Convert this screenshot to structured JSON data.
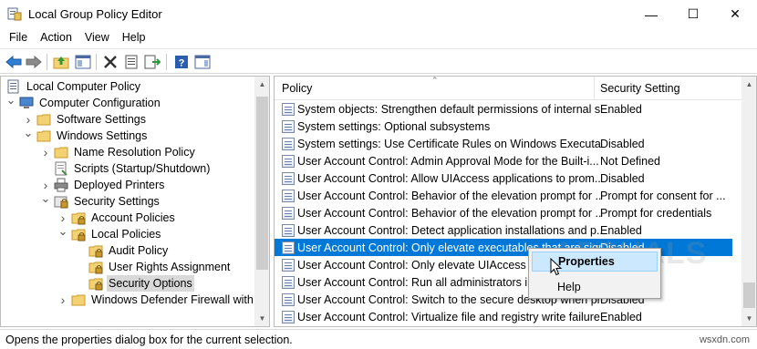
{
  "window": {
    "title": "Local Group Policy Editor",
    "minimize_glyph": "—",
    "maximize_glyph": "☐",
    "close_glyph": "✕"
  },
  "menu": [
    "File",
    "Action",
    "View",
    "Help"
  ],
  "toolbar": {
    "icons": [
      "back-icon",
      "forward-icon",
      "up-folder-icon",
      "show-hide-tree-icon",
      "delete-icon",
      "properties-icon",
      "export-list-icon",
      "help-icon",
      "show-pane-icon"
    ]
  },
  "tree": {
    "items": [
      {
        "label": "Local Computer Policy",
        "level": 0,
        "toggle": "",
        "icon": "computer-policy-icon"
      },
      {
        "label": "Computer Configuration",
        "level": 0,
        "toggle": "expanded",
        "icon": "computer-icon"
      },
      {
        "label": "Software Settings",
        "level": 1,
        "toggle": "collapsed",
        "icon": "folder-icon"
      },
      {
        "label": "Windows Settings",
        "level": 1,
        "toggle": "expanded",
        "icon": "folder-icon"
      },
      {
        "label": "Name Resolution Policy",
        "level": 2,
        "toggle": "collapsed",
        "icon": "folder-icon"
      },
      {
        "label": "Scripts (Startup/Shutdown)",
        "level": 2,
        "toggle": "",
        "icon": "script-icon"
      },
      {
        "label": "Deployed Printers",
        "level": 2,
        "toggle": "collapsed",
        "icon": "printer-icon"
      },
      {
        "label": "Security Settings",
        "level": 2,
        "toggle": "expanded",
        "icon": "security-icon"
      },
      {
        "label": "Account Policies",
        "level": 3,
        "toggle": "collapsed",
        "icon": "locked-folder-icon"
      },
      {
        "label": "Local Policies",
        "level": 3,
        "toggle": "expanded",
        "icon": "locked-folder-icon"
      },
      {
        "label": "Audit Policy",
        "level": 4,
        "toggle": "",
        "icon": "locked-folder-icon"
      },
      {
        "label": "User Rights Assignment",
        "level": 4,
        "toggle": "",
        "icon": "locked-folder-icon"
      },
      {
        "label": "Security Options",
        "level": 4,
        "toggle": "",
        "icon": "locked-folder-icon",
        "selected": true
      },
      {
        "label": "Windows Defender Firewall with A",
        "level": 3,
        "toggle": "collapsed",
        "icon": "folder-icon"
      }
    ]
  },
  "list": {
    "columns": [
      "Policy",
      "Security Setting"
    ],
    "rows": [
      {
        "policy": "System objects: Strengthen default permissions of internal s...",
        "setting": "Enabled"
      },
      {
        "policy": "System settings: Optional subsystems",
        "setting": ""
      },
      {
        "policy": "System settings: Use Certificate Rules on Windows Executabl...",
        "setting": "Disabled"
      },
      {
        "policy": "User Account Control: Admin Approval Mode for the Built-i...",
        "setting": "Not Defined"
      },
      {
        "policy": "User Account Control: Allow UIAccess applications to prom...",
        "setting": "Disabled"
      },
      {
        "policy": "User Account Control: Behavior of the elevation prompt for ...",
        "setting": "Prompt for consent for ..."
      },
      {
        "policy": "User Account Control: Behavior of the elevation prompt for ...",
        "setting": "Prompt for credentials"
      },
      {
        "policy": "User Account Control: Detect application installations and p...",
        "setting": "Enabled"
      },
      {
        "policy": "User Account Control: Only elevate executables that are sign...",
        "setting": "Disabled",
        "selected": true
      },
      {
        "policy": "User Account Control: Only elevate UIAccess ap",
        "setting": ""
      },
      {
        "policy": "User Account Control: Run all administrators in",
        "setting": ""
      },
      {
        "policy": "User Account Control: Switch to the secure desktop when pr...",
        "setting": "Disabled"
      },
      {
        "policy": "User Account Control: Virtualize file and registry write failure...",
        "setting": "Enabled"
      }
    ]
  },
  "context_menu": {
    "items": [
      "Properties",
      "Help"
    ]
  },
  "watermark": "APPUALS",
  "status": {
    "text": "Opens the properties dialog box for the current selection.",
    "site": "wsxdn.com"
  },
  "colors": {
    "selection": "#0078d7",
    "context_highlight": "#cce8ff"
  }
}
